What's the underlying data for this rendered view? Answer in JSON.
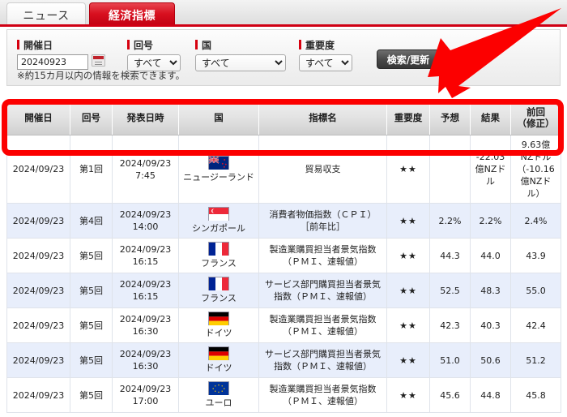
{
  "tabs": [
    {
      "id": "news",
      "label": "ニュース",
      "active": false
    },
    {
      "id": "economic",
      "label": "経済指標",
      "active": true
    }
  ],
  "search": {
    "date_field": {
      "label": "開催日",
      "value": "20240923",
      "icon": "calendar-icon"
    },
    "issue_field": {
      "label": "回号",
      "value": "すべて"
    },
    "country_field": {
      "label": "国",
      "value": "すべて"
    },
    "importance_field": {
      "label": "重要度",
      "value": "すべて"
    },
    "submit_label": "検索/更新",
    "note": "※約15カ月以内の情報を検索できます。"
  },
  "table": {
    "columns": [
      "開催日",
      "回号",
      "発表日時",
      "国",
      "指標名",
      "重要度",
      "予想",
      "結果",
      "前回\n（修正）"
    ],
    "columns_display": {
      "c0": "開催日",
      "c1": "回号",
      "c2": "発表日時",
      "c3": "国",
      "c4": "指標名",
      "c5": "重要度",
      "c6": "予想",
      "c7": "結果",
      "c8_line1": "前回",
      "c8_line2": "（修正）"
    },
    "rows": [
      {
        "date": "2024/09/23",
        "issue": "第1回",
        "datetime_line1": "2024/09/23",
        "datetime_line2": "7:45",
        "country": "ニュージーランド",
        "flag": "nz-flag",
        "indicator": "貿易収支",
        "importance": "★★",
        "forecast": "",
        "result": "-22.03億NZドル",
        "previous": "9.63億NZドル（-10.16億NZドル）"
      },
      {
        "date": "2024/09/23",
        "issue": "第4回",
        "datetime_line1": "2024/09/23",
        "datetime_line2": "14:00",
        "country": "シンガポール",
        "flag": "sg-flag",
        "indicator": "消費者物価指数（ＣＰＩ）［前年比］",
        "importance": "★★",
        "forecast": "2.2%",
        "result": "2.2%",
        "previous": "2.4%"
      },
      {
        "date": "2024/09/23",
        "issue": "第5回",
        "datetime_line1": "2024/09/23",
        "datetime_line2": "16:15",
        "country": "フランス",
        "flag": "fr-flag",
        "indicator": "製造業購買担当者景気指数（ＰＭＩ、速報値）",
        "importance": "★★",
        "forecast": "44.3",
        "result": "44.0",
        "previous": "43.9"
      },
      {
        "date": "2024/09/23",
        "issue": "第5回",
        "datetime_line1": "2024/09/23",
        "datetime_line2": "16:15",
        "country": "フランス",
        "flag": "fr-flag",
        "indicator": "サービス部門購買担当者景気指数（ＰＭＩ、速報値）",
        "importance": "★★",
        "forecast": "52.5",
        "result": "48.3",
        "previous": "55.0"
      },
      {
        "date": "2024/09/23",
        "issue": "第5回",
        "datetime_line1": "2024/09/23",
        "datetime_line2": "16:30",
        "country": "ドイツ",
        "flag": "de-flag",
        "indicator": "製造業購買担当者景気指数（ＰＭＩ、速報値）",
        "importance": "★★",
        "forecast": "42.3",
        "result": "40.3",
        "previous": "42.4"
      },
      {
        "date": "2024/09/23",
        "issue": "第5回",
        "datetime_line1": "2024/09/23",
        "datetime_line2": "16:30",
        "country": "ドイツ",
        "flag": "de-flag",
        "indicator": "サービス部門購買担当者景気指数（ＰＭＩ、速報値）",
        "importance": "★★",
        "forecast": "51.0",
        "result": "50.6",
        "previous": "51.2"
      },
      {
        "date": "2024/09/23",
        "issue": "第5回",
        "datetime_line1": "2024/09/23",
        "datetime_line2": "17:00",
        "country": "ユーロ",
        "flag": "eu-flag",
        "indicator": "製造業購買担当者景気指数（ＰＭＩ、速報値）",
        "importance": "★★",
        "forecast": "45.6",
        "result": "44.8",
        "previous": "45.8"
      }
    ]
  },
  "annotations": {
    "highlight_rect_target": "table-header-row",
    "arrow_color": "#fc0000",
    "rect_color": "#fc0000"
  },
  "colors": {
    "accent_red": "#d00014",
    "annotation_red": "#fc0000",
    "row_alt": "#e8eefb"
  }
}
